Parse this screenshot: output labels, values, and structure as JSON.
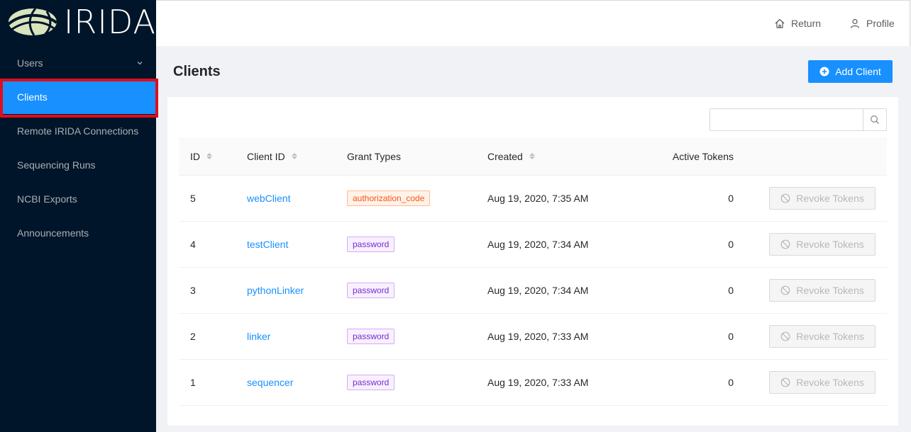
{
  "brand": {
    "logo_text": "IRIDA"
  },
  "colors": {
    "sidebar_bg": "#001529",
    "accent": "#1890ff",
    "highlight": "#e00d1c",
    "tag_orange": "#fa541c",
    "tag_purple": "#722ed1"
  },
  "sidebar": {
    "items": [
      {
        "label": "Users",
        "has_chevron": true
      },
      {
        "label": "Clients",
        "active": true
      },
      {
        "label": "Remote IRIDA Connections"
      },
      {
        "label": "Sequencing Runs"
      },
      {
        "label": "NCBI Exports"
      },
      {
        "label": "Announcements"
      }
    ]
  },
  "header": {
    "return_label": "Return",
    "return_icon": "home-icon",
    "profile_label": "Profile",
    "profile_icon": "user-icon"
  },
  "page": {
    "title": "Clients",
    "add_button_label": "Add Client",
    "add_button_icon": "plus-circle-icon"
  },
  "search": {
    "placeholder": "",
    "value": "",
    "icon": "search-icon"
  },
  "table": {
    "columns": [
      "ID",
      "Client ID",
      "Grant Types",
      "Created",
      "Active Tokens"
    ],
    "revoke_label": "Revoke Tokens",
    "revoke_icon": "stop-icon",
    "rows": [
      {
        "id": "5",
        "client_id": "webClient",
        "grant": "authorization_code",
        "created": "Aug 19, 2020, 7:35 AM",
        "tokens": "0"
      },
      {
        "id": "4",
        "client_id": "testClient",
        "grant": "password",
        "created": "Aug 19, 2020, 7:34 AM",
        "tokens": "0"
      },
      {
        "id": "3",
        "client_id": "pythonLinker",
        "grant": "password",
        "created": "Aug 19, 2020, 7:34 AM",
        "tokens": "0"
      },
      {
        "id": "2",
        "client_id": "linker",
        "grant": "password",
        "created": "Aug 19, 2020, 7:33 AM",
        "tokens": "0"
      },
      {
        "id": "1",
        "client_id": "sequencer",
        "grant": "password",
        "created": "Aug 19, 2020, 7:33 AM",
        "tokens": "0"
      }
    ]
  }
}
